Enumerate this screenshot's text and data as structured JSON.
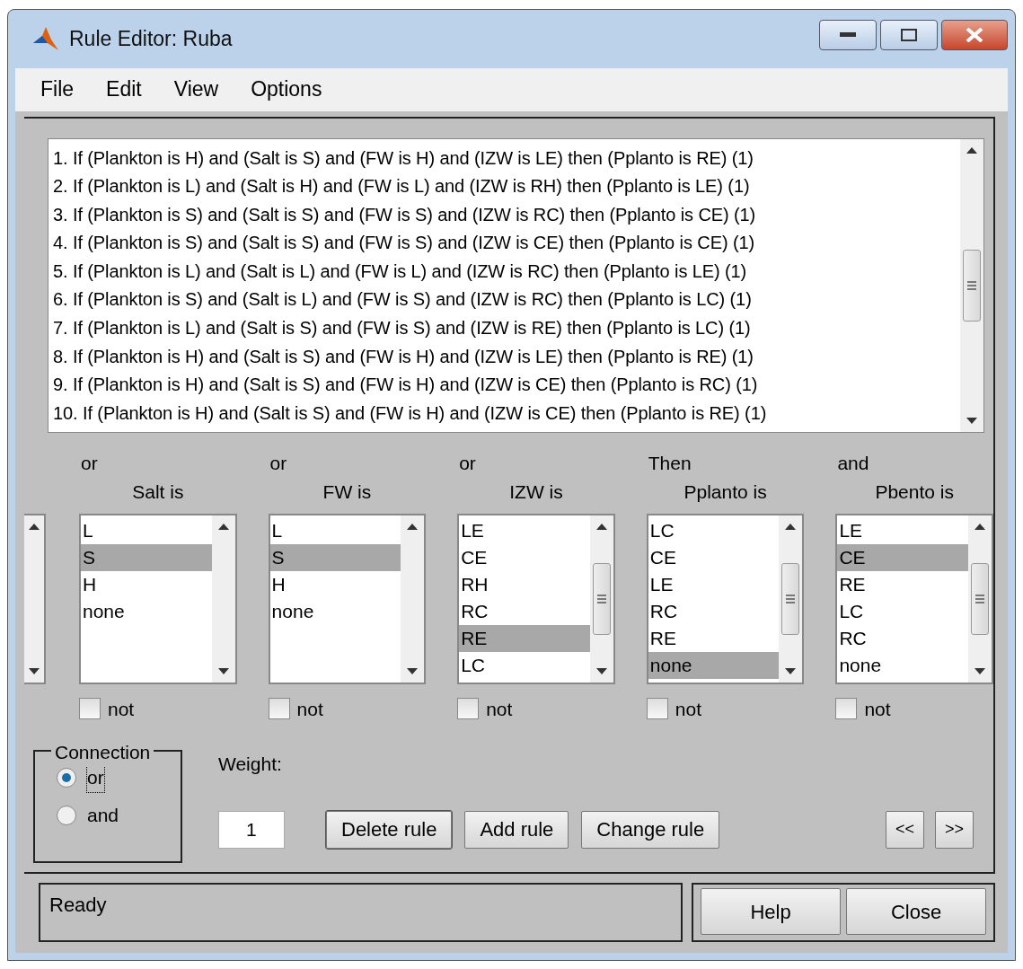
{
  "window": {
    "title": "Rule Editor: Ruba"
  },
  "menu": [
    "File",
    "Edit",
    "View",
    "Options"
  ],
  "rules": [
    "1. If (Plankton is H) and (Salt is S) and (FW is H) and (IZW is LE) then (Pplanto is RE) (1)",
    "2. If (Plankton is L) and (Salt is H) and (FW is L) and (IZW is RH) then (Pplanto is LE) (1)",
    "3. If (Plankton is S) and (Salt is S) and (FW is S) and (IZW is RC) then (Pplanto is CE) (1)",
    "4. If (Plankton is S) and (Salt is S) and (FW is S) and (IZW is CE) then (Pplanto is CE) (1)",
    "5. If (Plankton is L) and (Salt is L) and (FW is L) and (IZW is RC) then (Pplanto is LE) (1)",
    "6. If (Plankton is S) and (Salt is L) and (FW is S) and (IZW is RC) then (Pplanto is LC) (1)",
    "7. If (Plankton is L) and (Salt is S) and (FW is S) and (IZW is RE) then (Pplanto is LC) (1)",
    "8. If (Plankton is H) and (Salt is S) and (FW is H) and (IZW is LE) then (Pplanto is RE) (1)",
    "9. If (Plankton is H) and (Salt is S) and (FW is H) and (IZW is CE) then (Pplanto is RC) (1)",
    "10. If (Plankton is H) and (Salt is S) and (FW is H) and (IZW is CE) then (Pplanto is RE) (1)"
  ],
  "variables": [
    {
      "connector": "or",
      "label": "Salt is",
      "has_thumb": false,
      "not_checked": false,
      "not_label": "not",
      "items": [
        {
          "text": "L",
          "selected": false
        },
        {
          "text": "S",
          "selected": true
        },
        {
          "text": "H",
          "selected": false
        },
        {
          "text": "none",
          "selected": false
        }
      ]
    },
    {
      "connector": "or",
      "label": "FW is",
      "has_thumb": false,
      "not_checked": false,
      "not_label": "not",
      "items": [
        {
          "text": "L",
          "selected": false
        },
        {
          "text": "S",
          "selected": true
        },
        {
          "text": "H",
          "selected": false
        },
        {
          "text": "none",
          "selected": false
        }
      ]
    },
    {
      "connector": "or",
      "label": "IZW is",
      "has_thumb": true,
      "not_checked": false,
      "not_label": "not",
      "items": [
        {
          "text": "LE",
          "selected": false
        },
        {
          "text": "CE",
          "selected": false
        },
        {
          "text": "RH",
          "selected": false
        },
        {
          "text": "RC",
          "selected": false
        },
        {
          "text": "RE",
          "selected": true
        },
        {
          "text": "LC",
          "selected": false
        }
      ]
    },
    {
      "connector": "Then",
      "label": "Pplanto is",
      "has_thumb": true,
      "not_checked": false,
      "not_label": "not",
      "items": [
        {
          "text": "LC",
          "selected": false
        },
        {
          "text": "CE",
          "selected": false
        },
        {
          "text": "LE",
          "selected": false
        },
        {
          "text": "RC",
          "selected": false
        },
        {
          "text": "RE",
          "selected": false
        },
        {
          "text": "none",
          "selected": true
        }
      ]
    },
    {
      "connector": "and",
      "label": "Pbento is",
      "has_thumb": true,
      "not_checked": false,
      "not_label": "not",
      "items": [
        {
          "text": "LE",
          "selected": false
        },
        {
          "text": "CE",
          "selected": true
        },
        {
          "text": "RE",
          "selected": false
        },
        {
          "text": "LC",
          "selected": false
        },
        {
          "text": "RC",
          "selected": false
        },
        {
          "text": "none",
          "selected": false
        }
      ]
    }
  ],
  "connection": {
    "label": "Connection",
    "options": [
      {
        "label": "or",
        "selected": true
      },
      {
        "label": "and",
        "selected": false
      }
    ]
  },
  "weight": {
    "label": "Weight:",
    "value": "1"
  },
  "rule_buttons": [
    "Delete rule",
    "Add rule",
    "Change rule"
  ],
  "nav_buttons": [
    "<<",
    ">>"
  ],
  "status": "Ready",
  "footer_buttons": [
    "Help",
    "Close"
  ]
}
